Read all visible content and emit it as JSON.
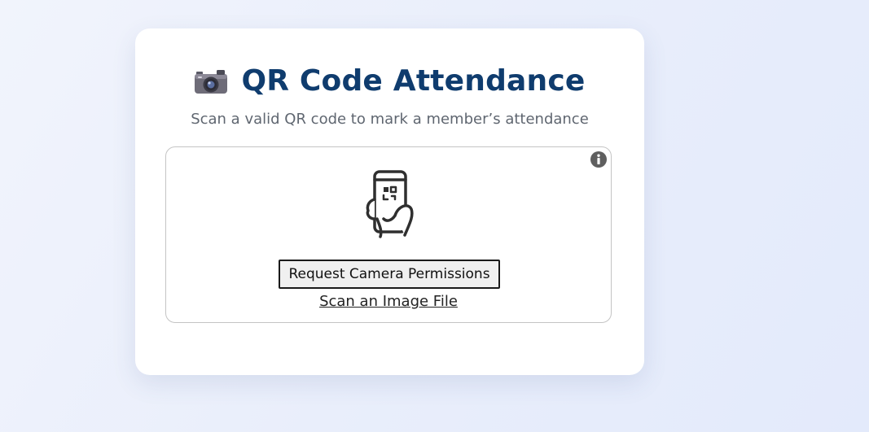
{
  "header": {
    "icon": "camera-icon",
    "title": "QR Code Attendance",
    "subtitle": "Scan a valid QR code to mark a member’s attendance"
  },
  "scanner": {
    "info_icon": "info-icon",
    "illustration_icon": "phone-qr-scan-icon",
    "request_button_label": "Request Camera Permissions",
    "scan_file_link_label": "Scan an Image File"
  },
  "colors": {
    "title": "#0f3c6e",
    "subtitle": "#5f6670",
    "card_background": "#ffffff",
    "page_background": "#e9eefb"
  }
}
